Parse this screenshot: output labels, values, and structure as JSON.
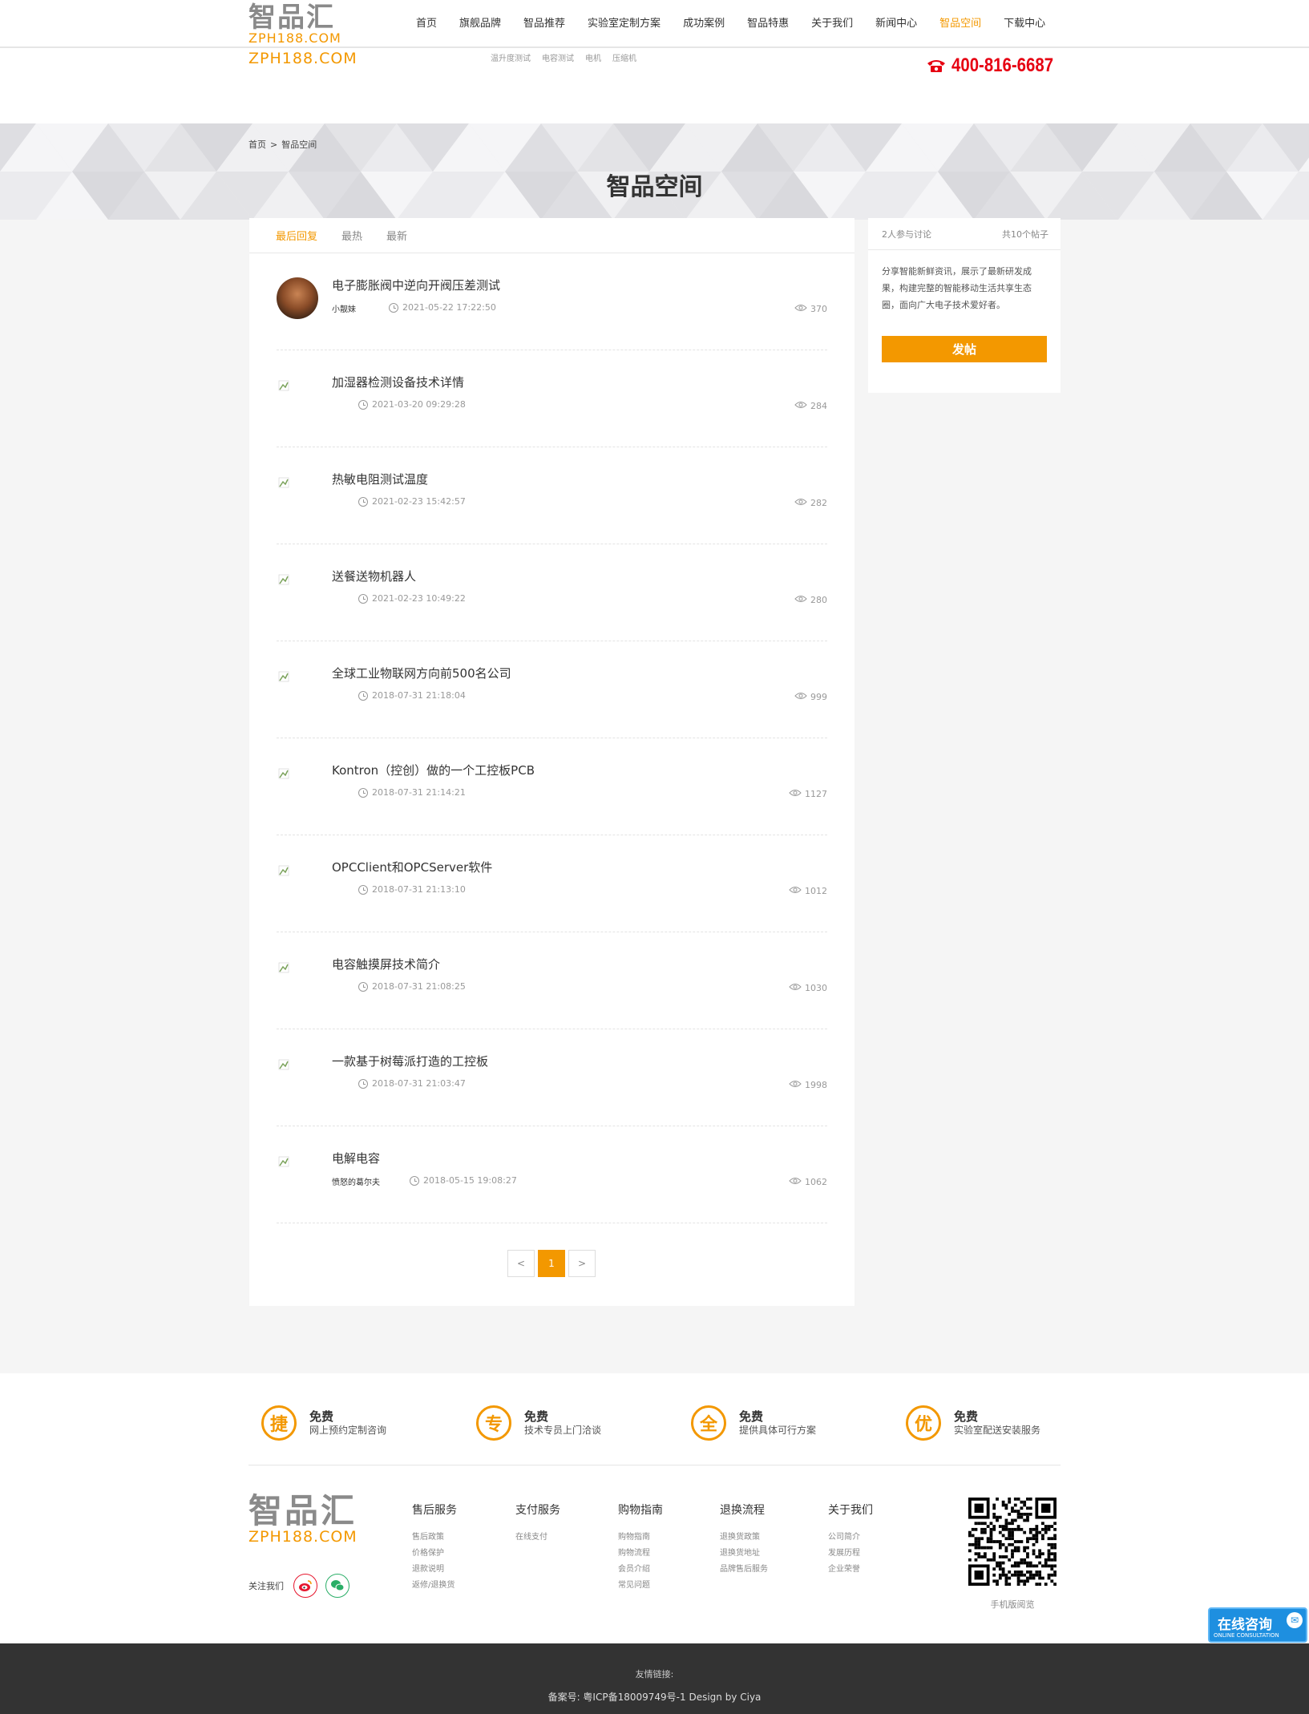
{
  "header": {
    "logo_cn": "智品汇",
    "logo_en": "ZPH188.COM",
    "logo_en_secondary": "ZPH188.COM",
    "nav": [
      {
        "label": "首页",
        "active": false
      },
      {
        "label": "旗舰品牌",
        "active": false
      },
      {
        "label": "智品推荐",
        "active": false
      },
      {
        "label": "实验室定制方案",
        "active": false
      },
      {
        "label": "成功案例",
        "active": false
      },
      {
        "label": "智品特惠",
        "active": false
      },
      {
        "label": "关于我们",
        "active": false
      },
      {
        "label": "新闻中心",
        "active": false
      },
      {
        "label": "智品空间",
        "active": true
      },
      {
        "label": "下载中心",
        "active": false
      }
    ],
    "sub_nav": [
      "温升度测试",
      "电容测试",
      "电机",
      "压缩机"
    ],
    "phone": "400-816-6687"
  },
  "breadcrumb": {
    "home": "首页",
    "separator": ">",
    "current": "智品空间"
  },
  "page_title": "智品空间",
  "tabs": [
    {
      "label": "最后回复",
      "active": true
    },
    {
      "label": "最热",
      "active": false
    },
    {
      "label": "最新",
      "active": false
    }
  ],
  "posts": [
    {
      "title": "电子膨胀阀中逆向开阀压差测试",
      "author": "小靓妹",
      "time": "2021-05-22 17:22:50",
      "views": "370",
      "has_avatar": true
    },
    {
      "title": "加湿器检测设备技术详情",
      "author": "",
      "time": "2021-03-20 09:29:28",
      "views": "284",
      "has_avatar": false
    },
    {
      "title": "热敏电阻测试温度",
      "author": "",
      "time": "2021-02-23 15:42:57",
      "views": "282",
      "has_avatar": false
    },
    {
      "title": "送餐送物机器人",
      "author": "",
      "time": "2021-02-23 10:49:22",
      "views": "280",
      "has_avatar": false
    },
    {
      "title": "全球工业物联网方向前500名公司",
      "author": "",
      "time": "2018-07-31 21:18:04",
      "views": "999",
      "has_avatar": false
    },
    {
      "title": "Kontron（控创）做的一个工控板PCB",
      "author": "",
      "time": "2018-07-31 21:14:21",
      "views": "1127",
      "has_avatar": false
    },
    {
      "title": "OPCClient和OPCServer软件",
      "author": "",
      "time": "2018-07-31 21:13:10",
      "views": "1012",
      "has_avatar": false
    },
    {
      "title": "电容触摸屏技术简介",
      "author": "",
      "time": "2018-07-31 21:08:25",
      "views": "1030",
      "has_avatar": false
    },
    {
      "title": "一款基于树莓派打造的工控板",
      "author": "",
      "time": "2018-07-31 21:03:47",
      "views": "1998",
      "has_avatar": false
    },
    {
      "title": "电解电容",
      "author": "愤怒的葛尔夫",
      "time": "2018-05-15 19:08:27",
      "views": "1062",
      "has_avatar": false
    }
  ],
  "pagination": {
    "prev": "<",
    "current": "1",
    "next": ">"
  },
  "sidebar": {
    "participants": "2人参与讨论",
    "post_count": "共10个帖子",
    "description": "分享智能新鲜资讯，展示了最新研发成果，构建完整的智能移动生活共享生态圈，面向广大电子技术爱好者。",
    "post_button": "发帖"
  },
  "features": [
    {
      "char": "捷",
      "title": "免费",
      "desc": "网上预约定制咨询"
    },
    {
      "char": "专",
      "title": "免费",
      "desc": "技术专员上门洽谈"
    },
    {
      "char": "全",
      "title": "免费",
      "desc": "提供具体可行方案"
    },
    {
      "char": "优",
      "title": "免费",
      "desc": "实验室配送安装服务"
    }
  ],
  "footer": {
    "logo_cn": "智品汇",
    "logo_en": "ZPH188.COM",
    "follow": "关注我们",
    "columns": [
      {
        "heading": "售后服务",
        "links": [
          "售后政策",
          "价格保护",
          "退款说明",
          "返修/退换货"
        ]
      },
      {
        "heading": "支付服务",
        "links": [
          "在线支付"
        ]
      },
      {
        "heading": "购物指南",
        "links": [
          "购物指南",
          "购物流程",
          "会员介绍",
          "常见问题"
        ]
      },
      {
        "heading": "退换流程",
        "links": [
          "退换货政策",
          "退换货地址",
          "品牌售后服务"
        ]
      },
      {
        "heading": "关于我们",
        "links": [
          "公司简介",
          "发展历程",
          "企业荣誉"
        ]
      }
    ],
    "qr_label": "手机版阅览",
    "friend_links": "友情链接:",
    "icp": "备案号: 粤ICP备18009749号-1  Design by  Ciya"
  },
  "consult": {
    "title": "在线咨询",
    "subtitle": "ONLINE CONSULTATION"
  },
  "colors": {
    "accent": "#f39800",
    "phone": "#e60012",
    "footer_bg": "#333333",
    "consult": "#1e8fe0"
  }
}
